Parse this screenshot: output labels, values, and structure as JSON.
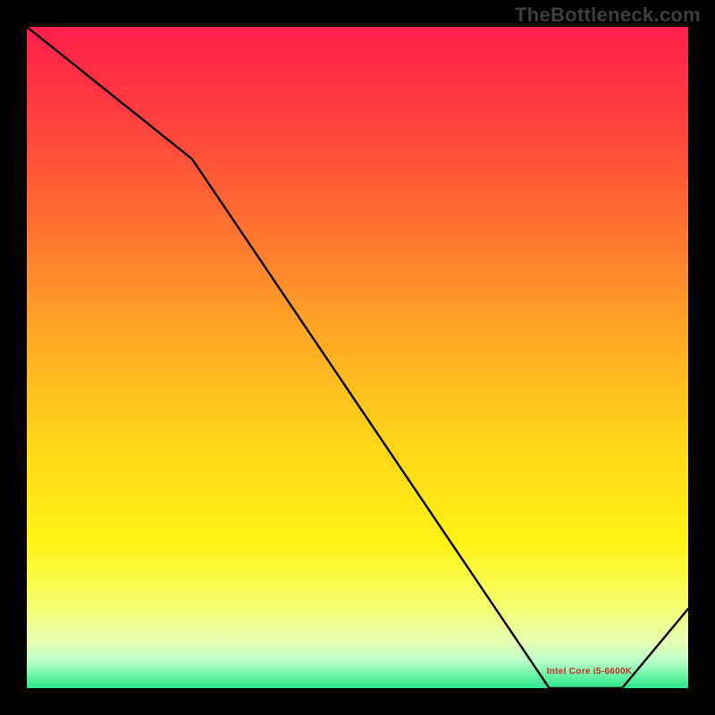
{
  "watermark": "TheBottleneck.com",
  "annotation_label": "Intel Core i5-6600K",
  "chart_data": {
    "type": "line",
    "title": "",
    "xlabel": "",
    "ylabel": "",
    "x_range": [
      0,
      100
    ],
    "y_range": [
      0,
      100
    ],
    "legend": false,
    "gradient_background": {
      "low": {
        "hue_from": 0.26,
        "sat": 0.95,
        "light": 0.62
      },
      "mid": {
        "hue_from": 0.17,
        "sat": 0.98,
        "light": 0.55
      },
      "high": {
        "hue_from": 0.0,
        "sat": 0.95,
        "light": 0.55
      }
    },
    "series": [
      {
        "name": "bottleneck-curve",
        "color": "#000000",
        "x": [
          0,
          25,
          79,
          90,
          100
        ],
        "y": [
          100,
          80,
          0,
          0,
          12
        ]
      }
    ],
    "annotations": [
      {
        "name": "recommended-label",
        "x": 84,
        "y": 2.5,
        "text_key": "annotation_label"
      }
    ]
  }
}
